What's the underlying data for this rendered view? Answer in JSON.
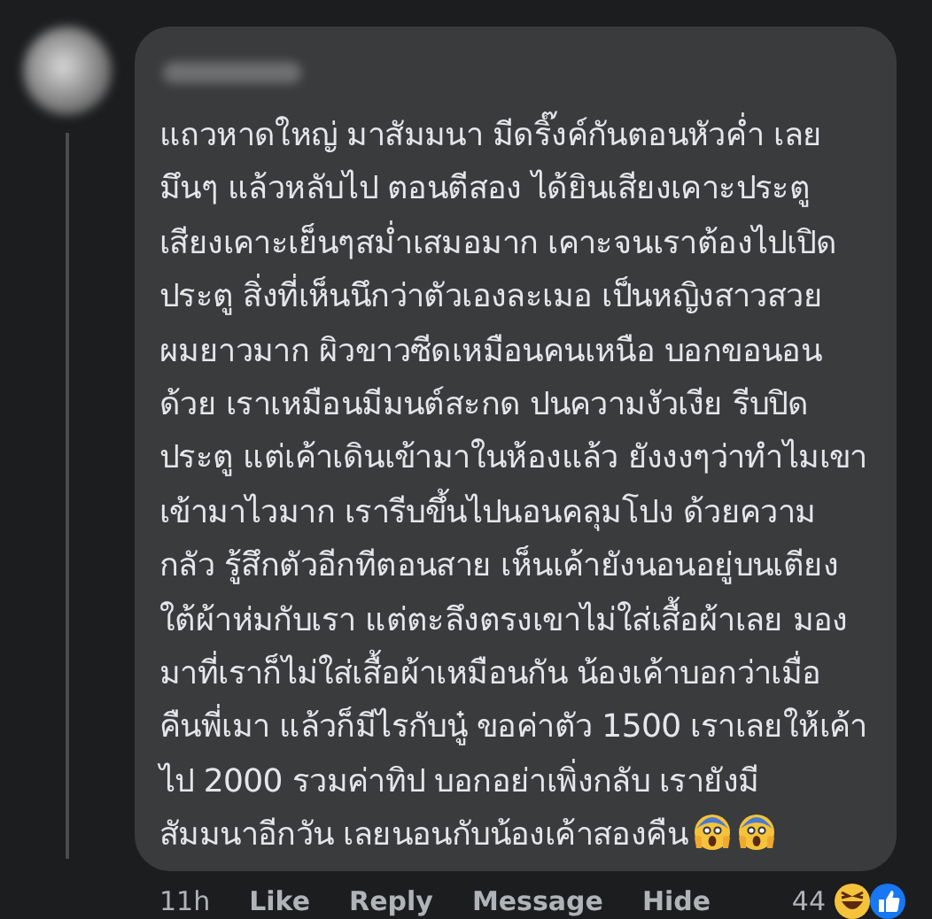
{
  "comment": {
    "text_lines": [
      "แถวหาดใหญ่ มาสัมมนา มีดริ๊งค์กันตอนหัวค่ำ เลย",
      "มึนๆ แล้วหลับไป ตอนตีสอง ได้ยินเสียงเคาะประตู",
      "เสียงเคาะเย็นๆสม่ำเสมอมาก เคาะจนเราต้องไปเปิด",
      "ประตู สิ่งที่เห็นนึกว่าตัวเองละเมอ เป็นหญิงสาวสวย",
      "ผมยาวมาก ผิวขาวซีดเหมือนคนเหนือ บอกขอนอน",
      "ด้วย เราเหมือนมีมนต์สะกด ปนความงัวเงีย รีบปิด",
      "ประตู แต่เค้าเดินเข้ามาในห้องแล้ว ยังงงๆว่าทำไมเขา",
      "เข้ามาไวมาก เรารีบขึ้นไปนอนคลุมโปง ด้วยความ",
      "กลัว รู้สึกตัวอีกทีตอนสาย เห็นเค้ายังนอนอยู่บนเตียง",
      "ใต้ผ้าห่มกับเรา แต่ตะลึงตรงเขาไม่ใส่เสื้อผ้าเลย มอง",
      "มาที่เราก็ไม่ใส่เสื้อผ้าเหมือนกัน น้องเค้าบอกว่าเมื่อ",
      "คืนพี่เมา แล้วก็มีไรกับนู๋ ขอค่าตัว 1500 เราเลยให้เค้า",
      "ไป 2000 รวมค่าทิป บอกอย่าเพิ่งกลับ เรายังมี",
      "สัมมนาอีกวัน เลยนอนกับน้องเค้าสองคืน"
    ],
    "emojis": [
      {
        "kind": "scream"
      },
      {
        "kind": "scream"
      }
    ]
  },
  "footer": {
    "time": "11h",
    "actions": [
      "Like",
      "Reply",
      "Message",
      "Hide"
    ],
    "reaction_count": "44",
    "reactions": [
      {
        "kind": "haha"
      },
      {
        "kind": "like"
      }
    ]
  }
}
